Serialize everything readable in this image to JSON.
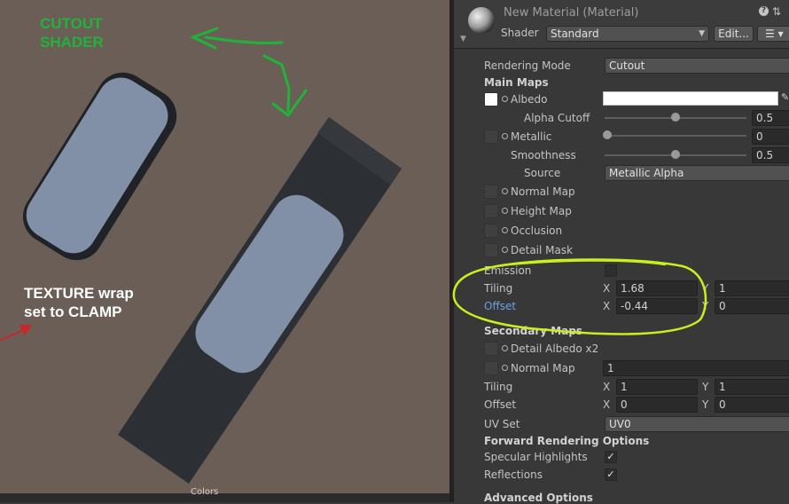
{
  "scene": {
    "annotations": {
      "cutout_line1": "CUTOUT",
      "cutout_line2": "SHADER",
      "texture_line1": "TEXTURE wrap",
      "texture_line2": "set to CLAMP"
    },
    "bottom_label": "Colors",
    "colors": {
      "background": "#6b5e56",
      "quad": "#2c2f33",
      "shape": "#8190a6",
      "annotation_green": "#1fb33a",
      "highlight": "#c8f01e"
    }
  },
  "inspector": {
    "title": "New Material (Material)",
    "shader_label": "Shader",
    "shader_value": "Standard",
    "edit_button": "Edit...",
    "list_button": "☰ ▾",
    "rendering_mode_label": "Rendering Mode",
    "rendering_mode_value": "Cutout",
    "main_maps": {
      "header": "Main Maps",
      "albedo": "Albedo",
      "alpha_cutoff_label": "Alpha Cutoff",
      "alpha_cutoff_value": "0.5",
      "alpha_cutoff_level": 0.5,
      "metallic": "Metallic",
      "metallic_value": "0",
      "metallic_level": 0,
      "smoothness_label": "Smoothness",
      "smoothness_value": "0.5",
      "smoothness_level": 0.5,
      "source_label": "Source",
      "source_value": "Metallic Alpha",
      "normal_map": "Normal Map",
      "height_map": "Height Map",
      "occlusion": "Occlusion",
      "detail_mask": "Detail Mask",
      "emission": "Emission",
      "tiling_label": "Tiling",
      "tiling_x": "1.68",
      "tiling_y": "1",
      "offset_label": "Offset",
      "offset_x": "-0.44",
      "offset_y": "0",
      "axis_x": "X",
      "axis_y": "Y"
    },
    "secondary_maps": {
      "header": "Secondary Maps",
      "detail_albedo": "Detail Albedo x2",
      "normal_map": "Normal Map",
      "normal_value": "1",
      "tiling_label": "Tiling",
      "tiling_x": "1",
      "tiling_y": "1",
      "offset_label": "Offset",
      "offset_x": "0",
      "offset_y": "0",
      "uv_set_label": "UV Set",
      "uv_set_value": "UV0"
    },
    "forward_rendering": {
      "header": "Forward Rendering Options",
      "specular_highlights": "Specular Highlights",
      "specular_checked": true,
      "reflections": "Reflections",
      "reflections_checked": true
    },
    "advanced_header": "Advanced Options"
  }
}
